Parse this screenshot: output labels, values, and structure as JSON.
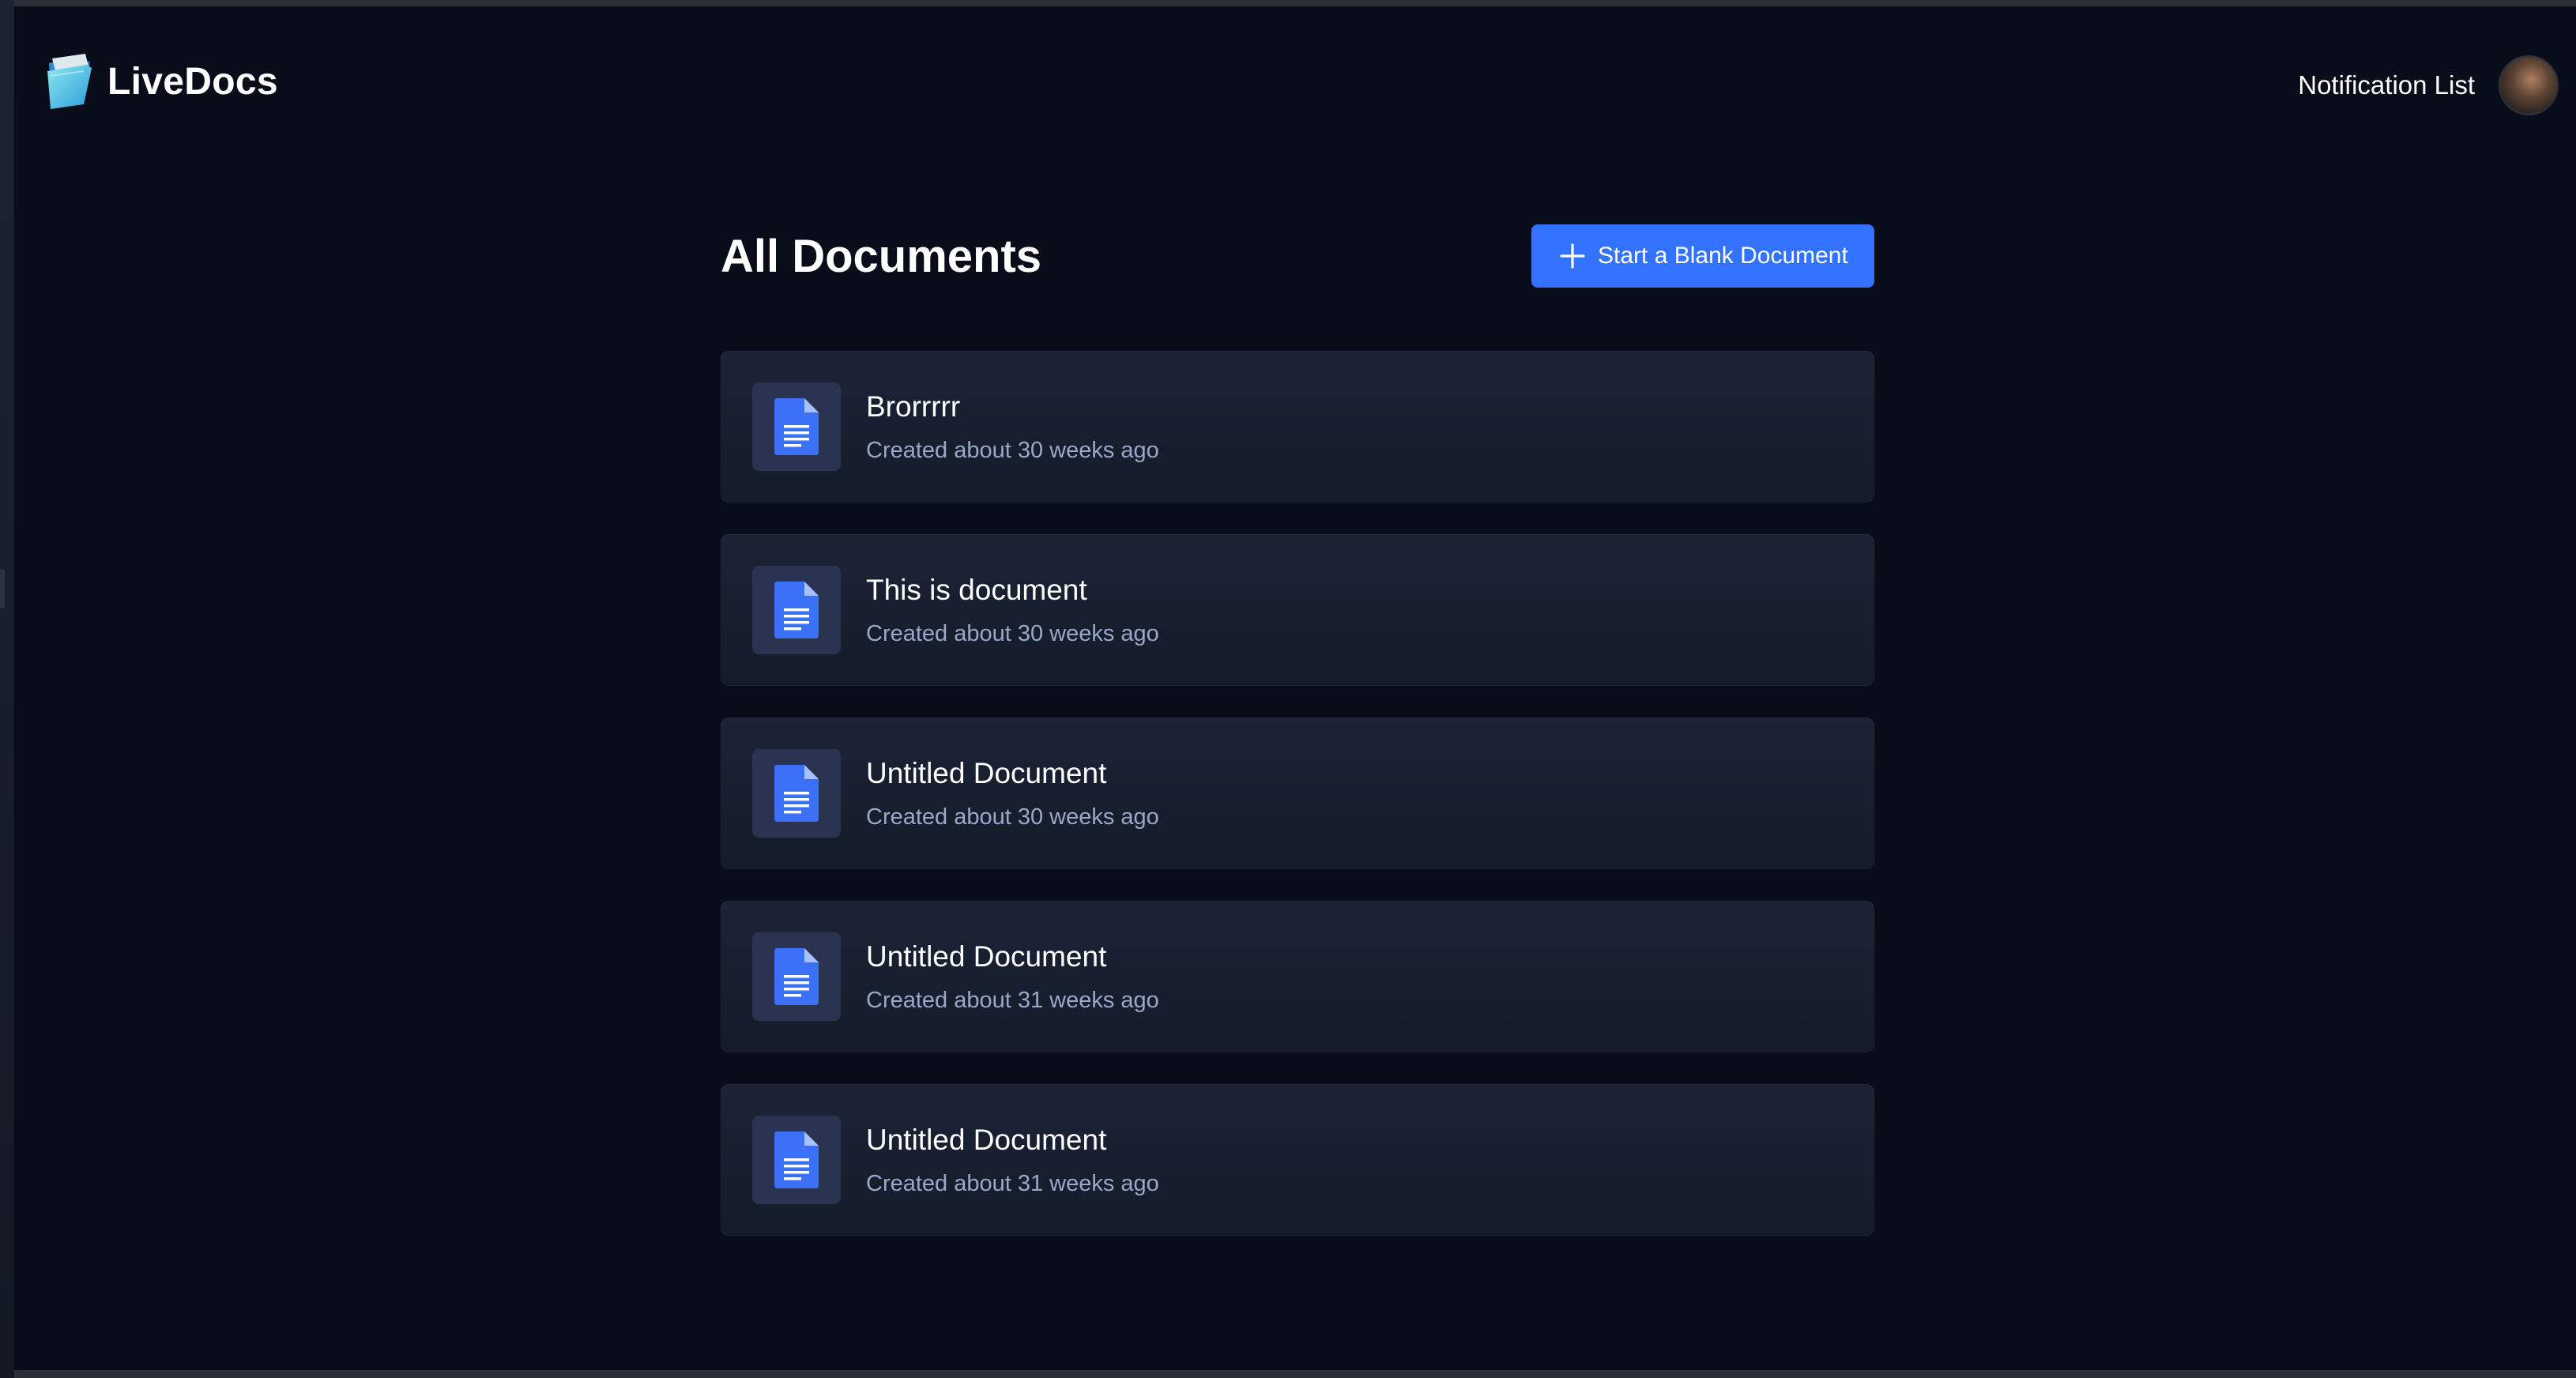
{
  "app": {
    "name": "LiveDocs"
  },
  "header": {
    "notification_label": "Notification List",
    "avatar_icon": "user-avatar"
  },
  "main": {
    "title": "All Documents",
    "new_button_label": "Start a Blank Document"
  },
  "documents": [
    {
      "title": "Brorrrrr",
      "created": "Created about 30 weeks ago"
    },
    {
      "title": "This is document",
      "created": "Created about 30 weeks ago"
    },
    {
      "title": "Untitled Document",
      "created": "Created about 30 weeks ago"
    },
    {
      "title": "Untitled Document",
      "created": "Created about 31 weeks ago"
    },
    {
      "title": "Untitled Document",
      "created": "Created about 31 weeks ago"
    }
  ],
  "colors": {
    "background": "#080d19",
    "accent": "#3371ff",
    "card": "#1b2335",
    "muted_text": "#9aa8c8"
  }
}
